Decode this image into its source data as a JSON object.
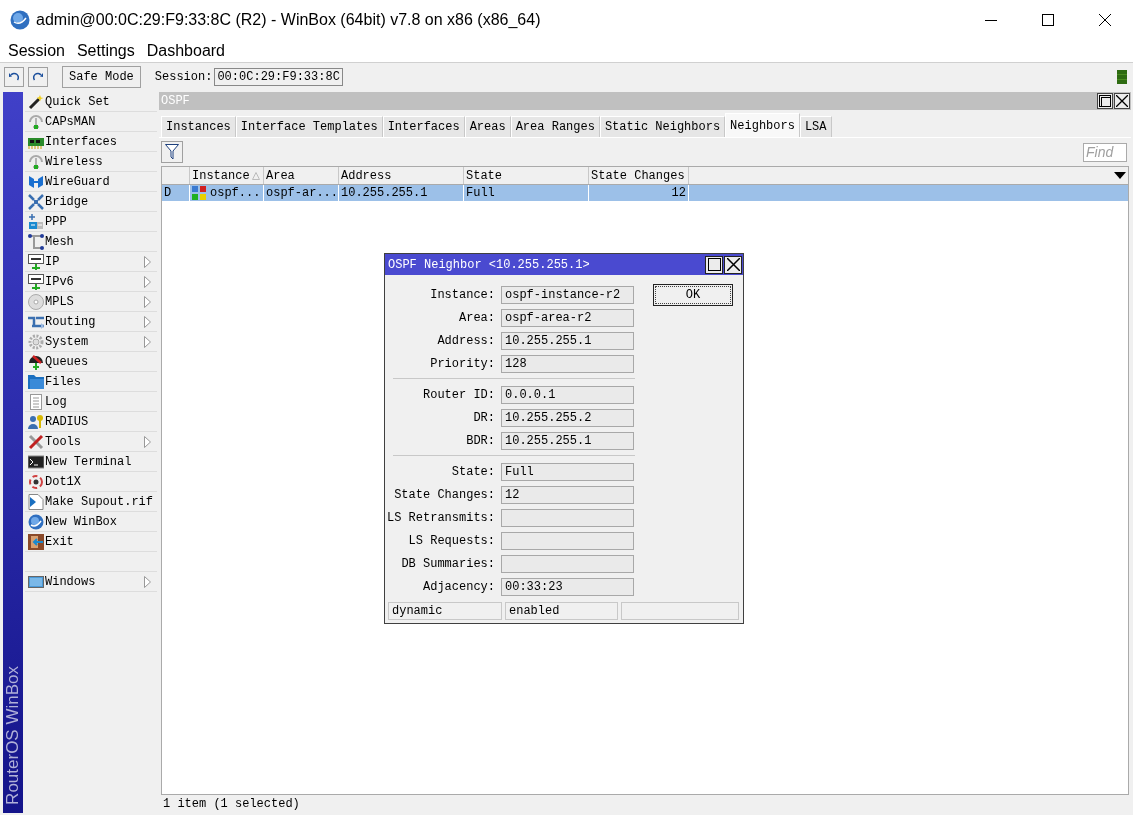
{
  "window": {
    "title": "admin@00:0C:29:F9:33:8C (R2) - WinBox (64bit) v7.8 on x86 (x86_64)"
  },
  "menu": [
    "Session",
    "Settings",
    "Dashboard"
  ],
  "toolbar": {
    "safe_mode": "Safe Mode",
    "session_label": "Session:",
    "session": "00:0C:29:F9:33:8C"
  },
  "sidebar": {
    "brand": "RouterOS WinBox",
    "items": [
      {
        "kind": "item",
        "label": "Quick Set",
        "submenu": false
      },
      {
        "kind": "item",
        "label": "CAPsMAN",
        "submenu": false
      },
      {
        "kind": "item",
        "label": "Interfaces",
        "submenu": false
      },
      {
        "kind": "item",
        "label": "Wireless",
        "submenu": false
      },
      {
        "kind": "item",
        "label": "WireGuard",
        "submenu": false
      },
      {
        "kind": "item",
        "label": "Bridge",
        "submenu": false
      },
      {
        "kind": "item",
        "label": "PPP",
        "submenu": false
      },
      {
        "kind": "item",
        "label": "Mesh",
        "submenu": false
      },
      {
        "kind": "item",
        "label": "IP",
        "submenu": true
      },
      {
        "kind": "item",
        "label": "IPv6",
        "submenu": true
      },
      {
        "kind": "item",
        "label": "MPLS",
        "submenu": true
      },
      {
        "kind": "item",
        "label": "Routing",
        "submenu": true
      },
      {
        "kind": "item",
        "label": "System",
        "submenu": true
      },
      {
        "kind": "item",
        "label": "Queues",
        "submenu": false
      },
      {
        "kind": "item",
        "label": "Files",
        "submenu": false
      },
      {
        "kind": "item",
        "label": "Log",
        "submenu": false
      },
      {
        "kind": "item",
        "label": "RADIUS",
        "submenu": false
      },
      {
        "kind": "item",
        "label": "Tools",
        "submenu": true
      },
      {
        "kind": "item",
        "label": "New Terminal",
        "submenu": false
      },
      {
        "kind": "item",
        "label": "Dot1X",
        "submenu": false
      },
      {
        "kind": "item",
        "label": "Make Supout.rif",
        "submenu": false
      },
      {
        "kind": "item",
        "label": "New WinBox",
        "submenu": false
      },
      {
        "kind": "item",
        "label": "Exit",
        "submenu": false
      },
      {
        "kind": "gap"
      },
      {
        "kind": "item",
        "label": "Windows",
        "submenu": true
      }
    ]
  },
  "ospf": {
    "title": "OSPF",
    "tabs": [
      {
        "label": "Instances",
        "selected": false
      },
      {
        "label": "Interface Templates",
        "selected": false
      },
      {
        "label": "Interfaces",
        "selected": false
      },
      {
        "label": "Areas",
        "selected": false
      },
      {
        "label": "Area Ranges",
        "selected": false
      },
      {
        "label": "Static Neighbors",
        "selected": false
      },
      {
        "label": "Neighbors",
        "selected": true
      },
      {
        "label": "LSA",
        "selected": false
      }
    ],
    "find": {
      "placeholder": "Find"
    },
    "columns": [
      {
        "label": "Instance",
        "sorted": true
      },
      {
        "label": "Area",
        "sorted": false
      },
      {
        "label": "Address",
        "sorted": false
      },
      {
        "label": "State",
        "sorted": false
      },
      {
        "label": "State Changes",
        "sorted": false
      }
    ],
    "rows": [
      {
        "flag": "D",
        "cells": [
          "ospf...",
          "ospf-ar...",
          "10.255.255.1",
          "Full",
          "12"
        ],
        "selected": true
      }
    ],
    "status": "1 item (1 selected)"
  },
  "dialog": {
    "title": "OSPF Neighbor <10.255.255.1>",
    "ok": "OK",
    "groups": [
      {
        "fields": [
          {
            "label": "Instance:",
            "value": "ospf-instance-r2"
          },
          {
            "label": "Area:",
            "value": "ospf-area-r2"
          },
          {
            "label": "Address:",
            "value": "10.255.255.1"
          },
          {
            "label": "Priority:",
            "value": "128"
          }
        ]
      },
      {
        "fields": [
          {
            "label": "Router ID:",
            "value": "0.0.0.1"
          },
          {
            "label": "DR:",
            "value": "10.255.255.2"
          },
          {
            "label": "BDR:",
            "value": "10.255.255.1"
          }
        ]
      },
      {
        "fields": [
          {
            "label": "State:",
            "value": "Full"
          },
          {
            "label": "State Changes:",
            "value": "12"
          },
          {
            "label": "LS Retransmits:"
          },
          {
            "label": "LS Requests:"
          },
          {
            "label": "DB Summaries:"
          },
          {
            "label": "Adjacency:",
            "value": "00:33:23"
          }
        ]
      }
    ],
    "status": [
      "dynamic",
      "enabled"
    ]
  }
}
